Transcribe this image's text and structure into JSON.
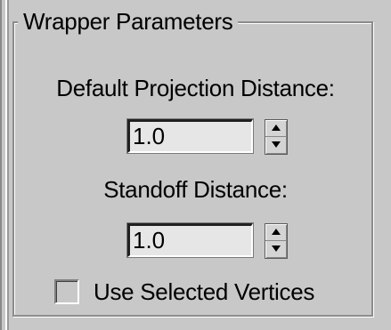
{
  "group": {
    "title": "Wrapper Parameters"
  },
  "projection": {
    "label": "Default Projection Distance:",
    "value": "1.0"
  },
  "standoff": {
    "label": "Standoff Distance:",
    "value": "1.0"
  },
  "options": {
    "use_selected_vertices_label": "Use Selected Vertices",
    "use_selected_vertices_checked": false
  },
  "icons": {
    "spinner_up": "spinner-up-arrow-icon",
    "spinner_down": "spinner-down-arrow-icon"
  }
}
